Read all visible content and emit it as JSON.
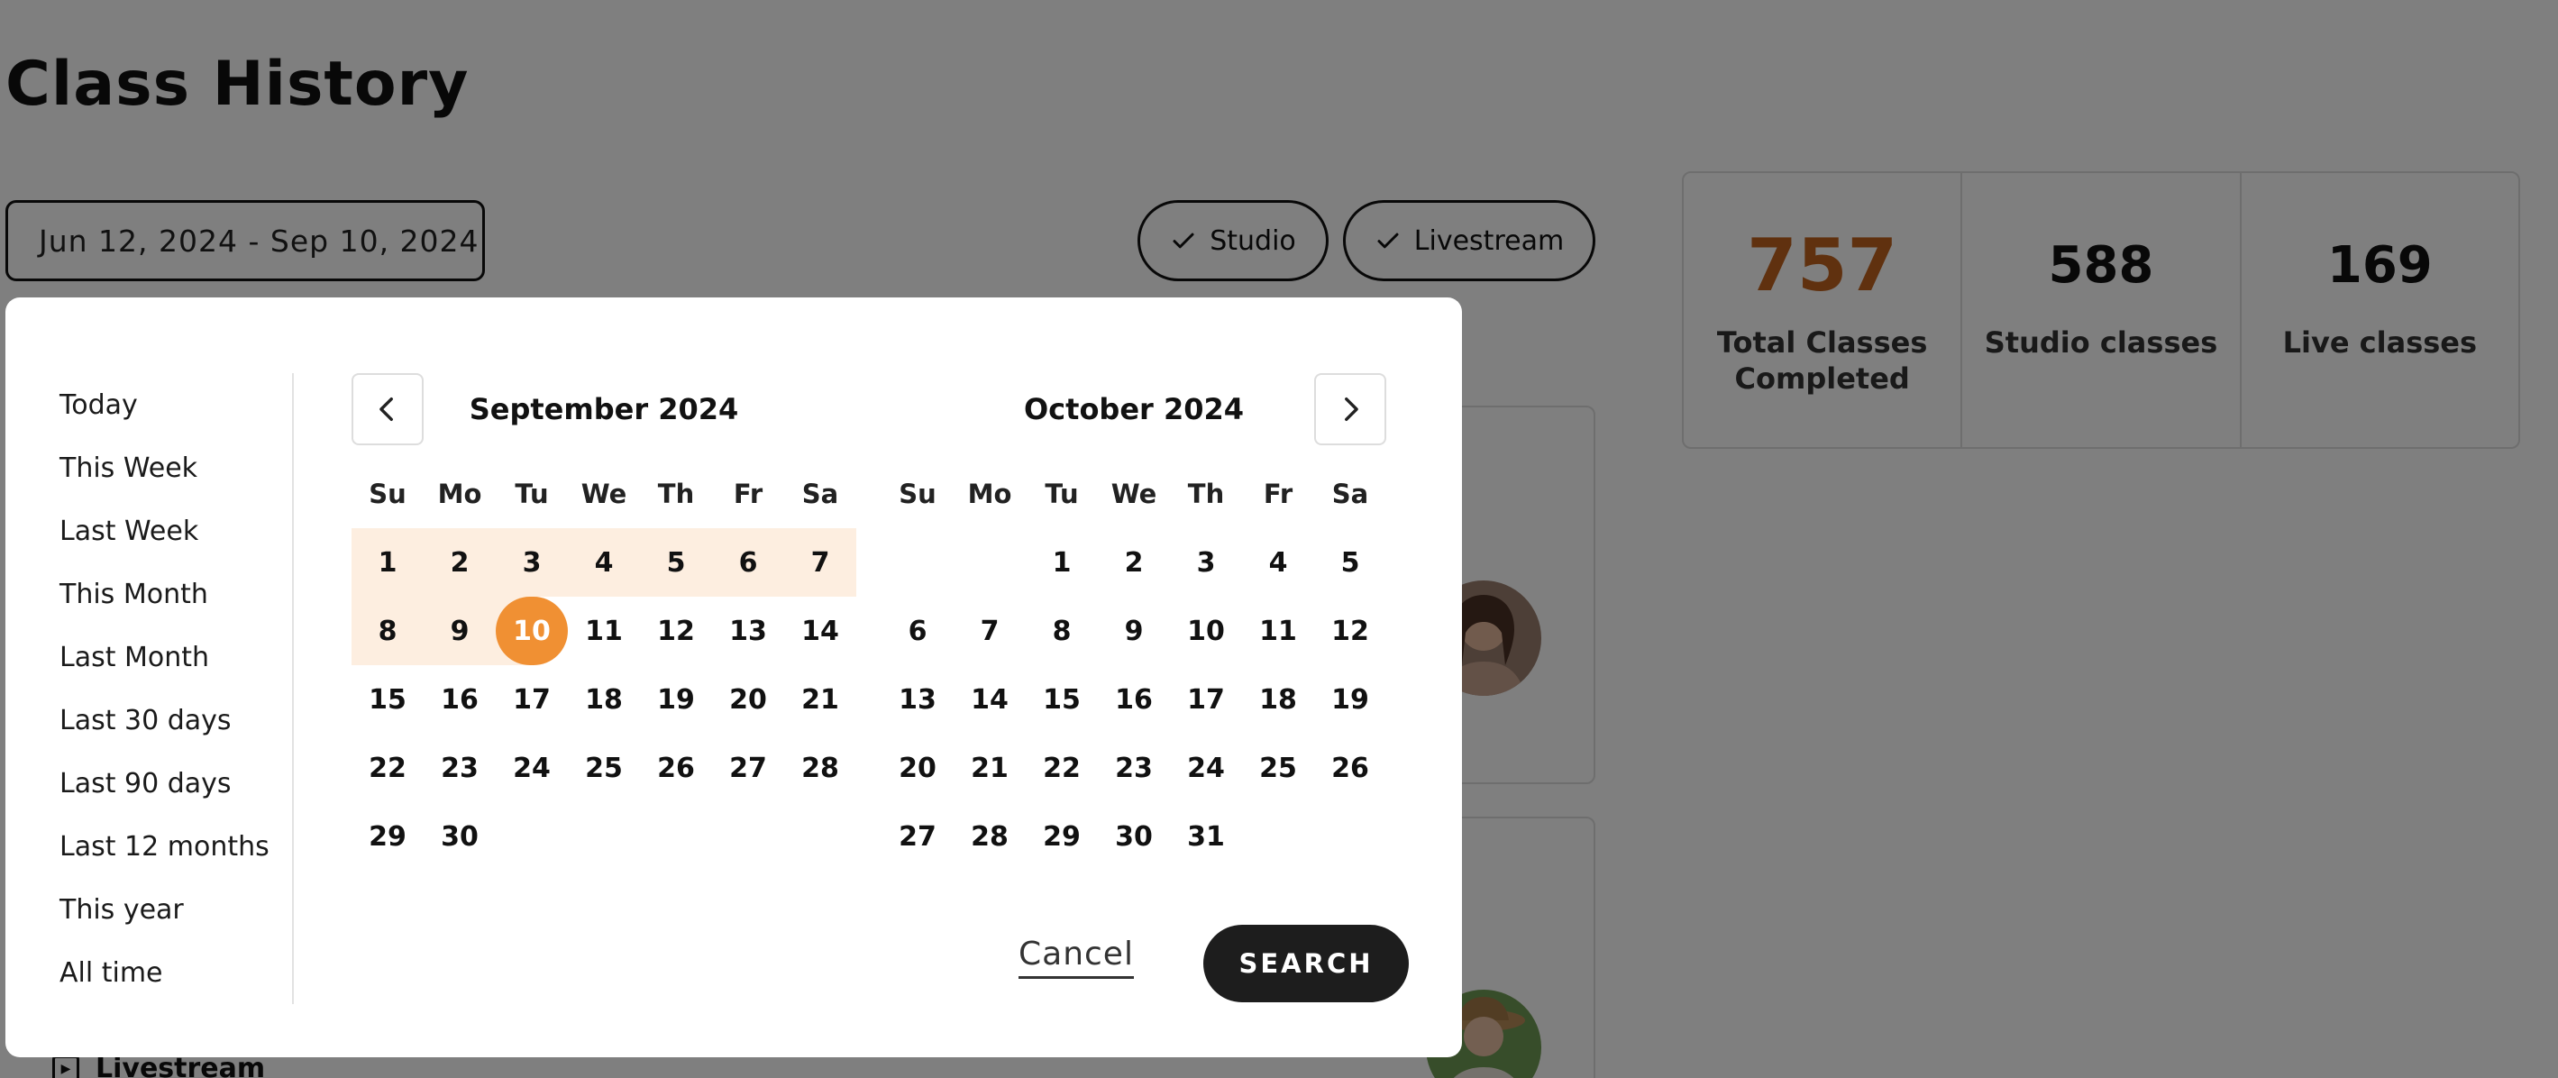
{
  "page": {
    "title": "Class History"
  },
  "filters": {
    "date_range": "Jun 12, 2024 - Sep 10, 2024",
    "chips": [
      {
        "label": "Studio",
        "checked": true
      },
      {
        "label": "Livestream",
        "checked": true
      }
    ]
  },
  "stats": [
    {
      "value": "757",
      "label": "Total Classes Completed",
      "accent": "#c0621f"
    },
    {
      "value": "588",
      "label": "Studio classes"
    },
    {
      "value": "169",
      "label": "Live classes"
    }
  ],
  "background_list": {
    "item_type_label": "Livestream"
  },
  "date_picker": {
    "presets": [
      "Today",
      "This Week",
      "Last Week",
      "This Month",
      "Last Month",
      "Last 30 days",
      "Last 90 days",
      "Last 12 months",
      "This year",
      "All time"
    ],
    "weekdays": [
      "Su",
      "Mo",
      "Tu",
      "We",
      "Th",
      "Fr",
      "Sa"
    ],
    "months": [
      {
        "title": "September 2024",
        "first_weekday": 0,
        "days": 30,
        "range_start": 1,
        "range_end": 10
      },
      {
        "title": "October 2024",
        "first_weekday": 2,
        "days": 31
      }
    ],
    "cancel_label": "Cancel",
    "search_label": "SEARCH",
    "colors": {
      "range_fill": "#fdeee0",
      "selected": "#f09033",
      "search_bg": "#1d1d1d"
    }
  }
}
